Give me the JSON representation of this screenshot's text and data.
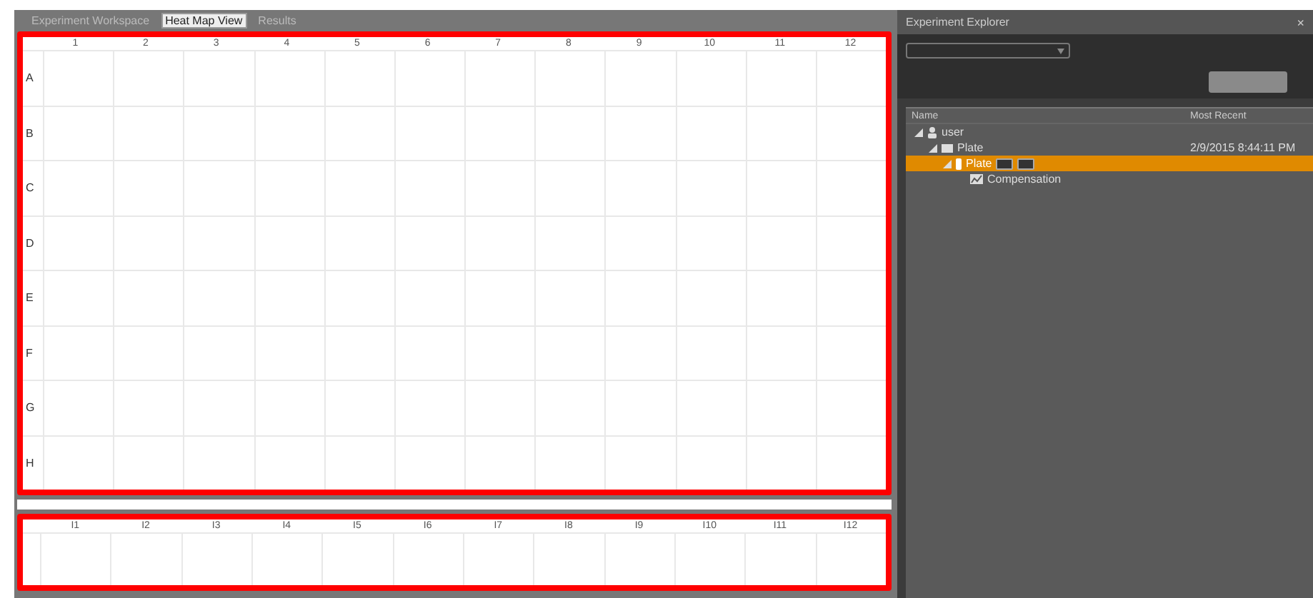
{
  "tabs": [
    {
      "label": "Experiment Workspace",
      "selected": false
    },
    {
      "label": "Heat Map View",
      "selected": true
    },
    {
      "label": "Results",
      "selected": false
    }
  ],
  "plate": {
    "columns": [
      "1",
      "2",
      "3",
      "4",
      "5",
      "6",
      "7",
      "8",
      "9",
      "10",
      "11",
      "12"
    ],
    "rows": [
      "A",
      "B",
      "C",
      "D",
      "E",
      "F",
      "G",
      "H"
    ]
  },
  "strip": {
    "columns": [
      "I1",
      "I2",
      "I3",
      "I4",
      "I5",
      "I6",
      "I7",
      "I8",
      "I9",
      "I10",
      "I11",
      "I12"
    ]
  },
  "explorer": {
    "title": "Experiment Explorer",
    "close": "×",
    "columns": [
      "Name",
      "Most Recent"
    ],
    "tree": [
      {
        "label": "user",
        "kind": "user",
        "expanded": true,
        "selected": false,
        "children": [
          {
            "label": "Plate",
            "kind": "plate",
            "expanded": true,
            "selected": false,
            "recent": "2/9/2015 8:44:11 PM",
            "children": [
              {
                "label": "Plate",
                "kind": "run",
                "expanded": true,
                "selected": true,
                "children": [
                  {
                    "label": "Compensation",
                    "kind": "chart",
                    "selected": false
                  }
                ]
              }
            ]
          }
        ]
      }
    ]
  }
}
